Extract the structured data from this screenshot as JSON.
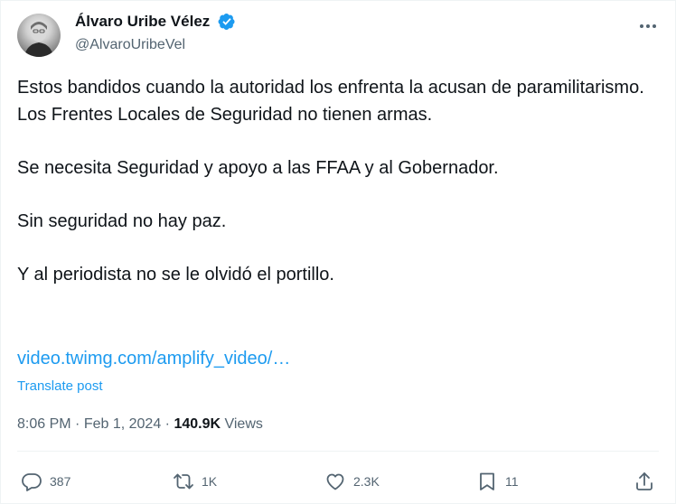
{
  "post": {
    "author": {
      "display_name": "Álvaro Uribe Vélez",
      "handle": "@AlvaroUribeVel",
      "verified": true,
      "verified_color": "#1d9bf0"
    },
    "paragraphs": [
      "Estos bandidos cuando la autoridad los enfrenta la acusan de paramilitarismo.",
      "Los Frentes Locales de Seguridad no tienen armas.",
      "",
      "Se necesita Seguridad y apoyo a las FFAA y al Gobernador.",
      "",
      "Sin seguridad no hay paz.",
      "",
      "Y al periodista no se le olvidó el portillo."
    ],
    "link_text": "video.twimg.com/amplify_video/…",
    "translate_label": "Translate post",
    "time": "8:06 PM",
    "separator": " · ",
    "date": "Feb 1, 2024",
    "views_count": "140.9K",
    "views_label": "Views"
  },
  "actions": {
    "replies": "387",
    "reposts": "1K",
    "likes": "2.3K",
    "bookmarks": "11"
  },
  "icons": {
    "more": "more-horizontal-icon",
    "reply": "reply-icon",
    "repost": "repost-icon",
    "like": "heart-icon",
    "bookmark": "bookmark-icon",
    "share": "share-icon"
  },
  "colors": {
    "accent": "#1d9bf0",
    "text": "#0f1419",
    "muted": "#536471"
  }
}
